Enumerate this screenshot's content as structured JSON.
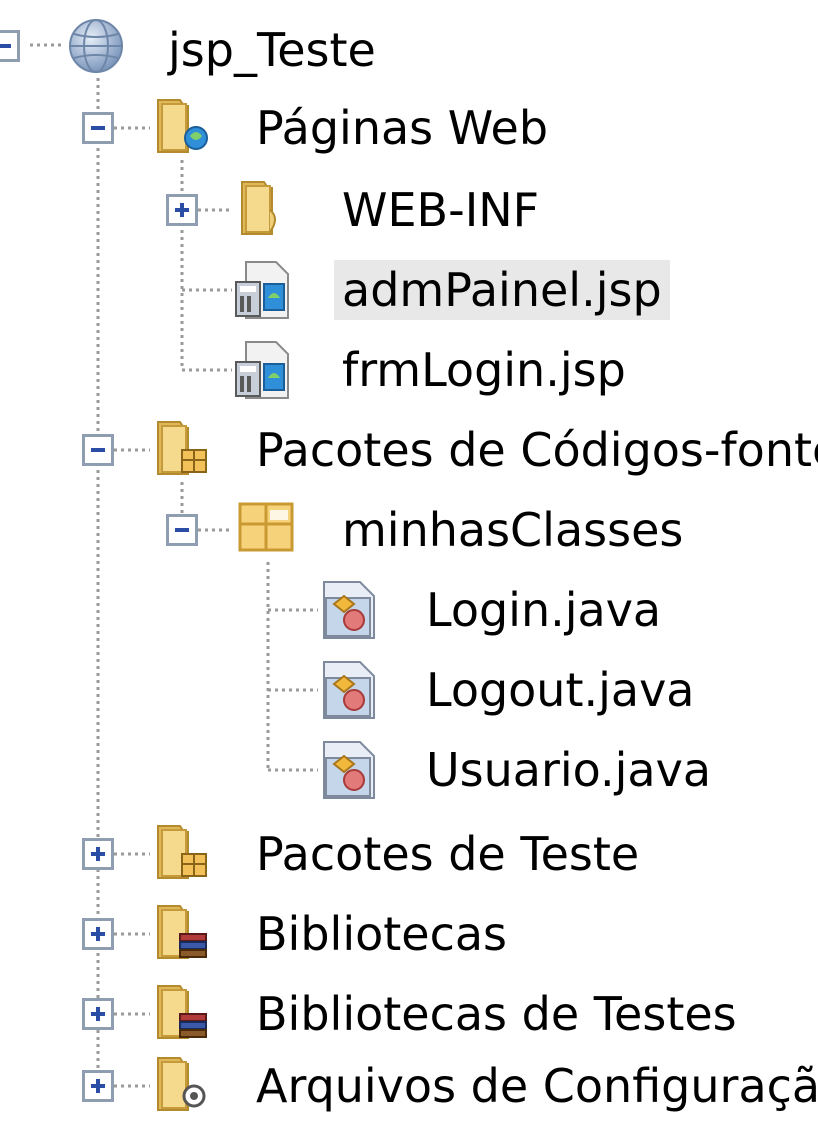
{
  "project": {
    "name": "jsp_Teste",
    "icon": "globe-project-icon"
  },
  "nodes": [
    {
      "label": "Páginas Web",
      "icon": "folder-web-icon",
      "expanded": true
    },
    {
      "label": "WEB-INF",
      "icon": "folder-icon",
      "expanded": false
    },
    {
      "label": "admPainel.jsp",
      "icon": "jsp-file-icon",
      "selected": true
    },
    {
      "label": "frmLogin.jsp",
      "icon": "jsp-file-icon"
    },
    {
      "label": "Pacotes de Códigos-fonte",
      "icon": "folder-package-icon",
      "expanded": true
    },
    {
      "label": "minhasClasses",
      "icon": "package-icon",
      "expanded": true
    },
    {
      "label": "Login.java",
      "icon": "java-file-icon"
    },
    {
      "label": "Logout.java",
      "icon": "java-file-icon"
    },
    {
      "label": "Usuario.java",
      "icon": "java-file-icon"
    },
    {
      "label": "Pacotes de Teste",
      "icon": "folder-package-icon",
      "expanded": false
    },
    {
      "label": "Bibliotecas",
      "icon": "folder-library-icon",
      "expanded": false
    },
    {
      "label": "Bibliotecas de Testes",
      "icon": "folder-library-icon",
      "expanded": false
    },
    {
      "label": "Arquivos de Configuração",
      "icon": "folder-config-icon",
      "expanded": false
    }
  ]
}
